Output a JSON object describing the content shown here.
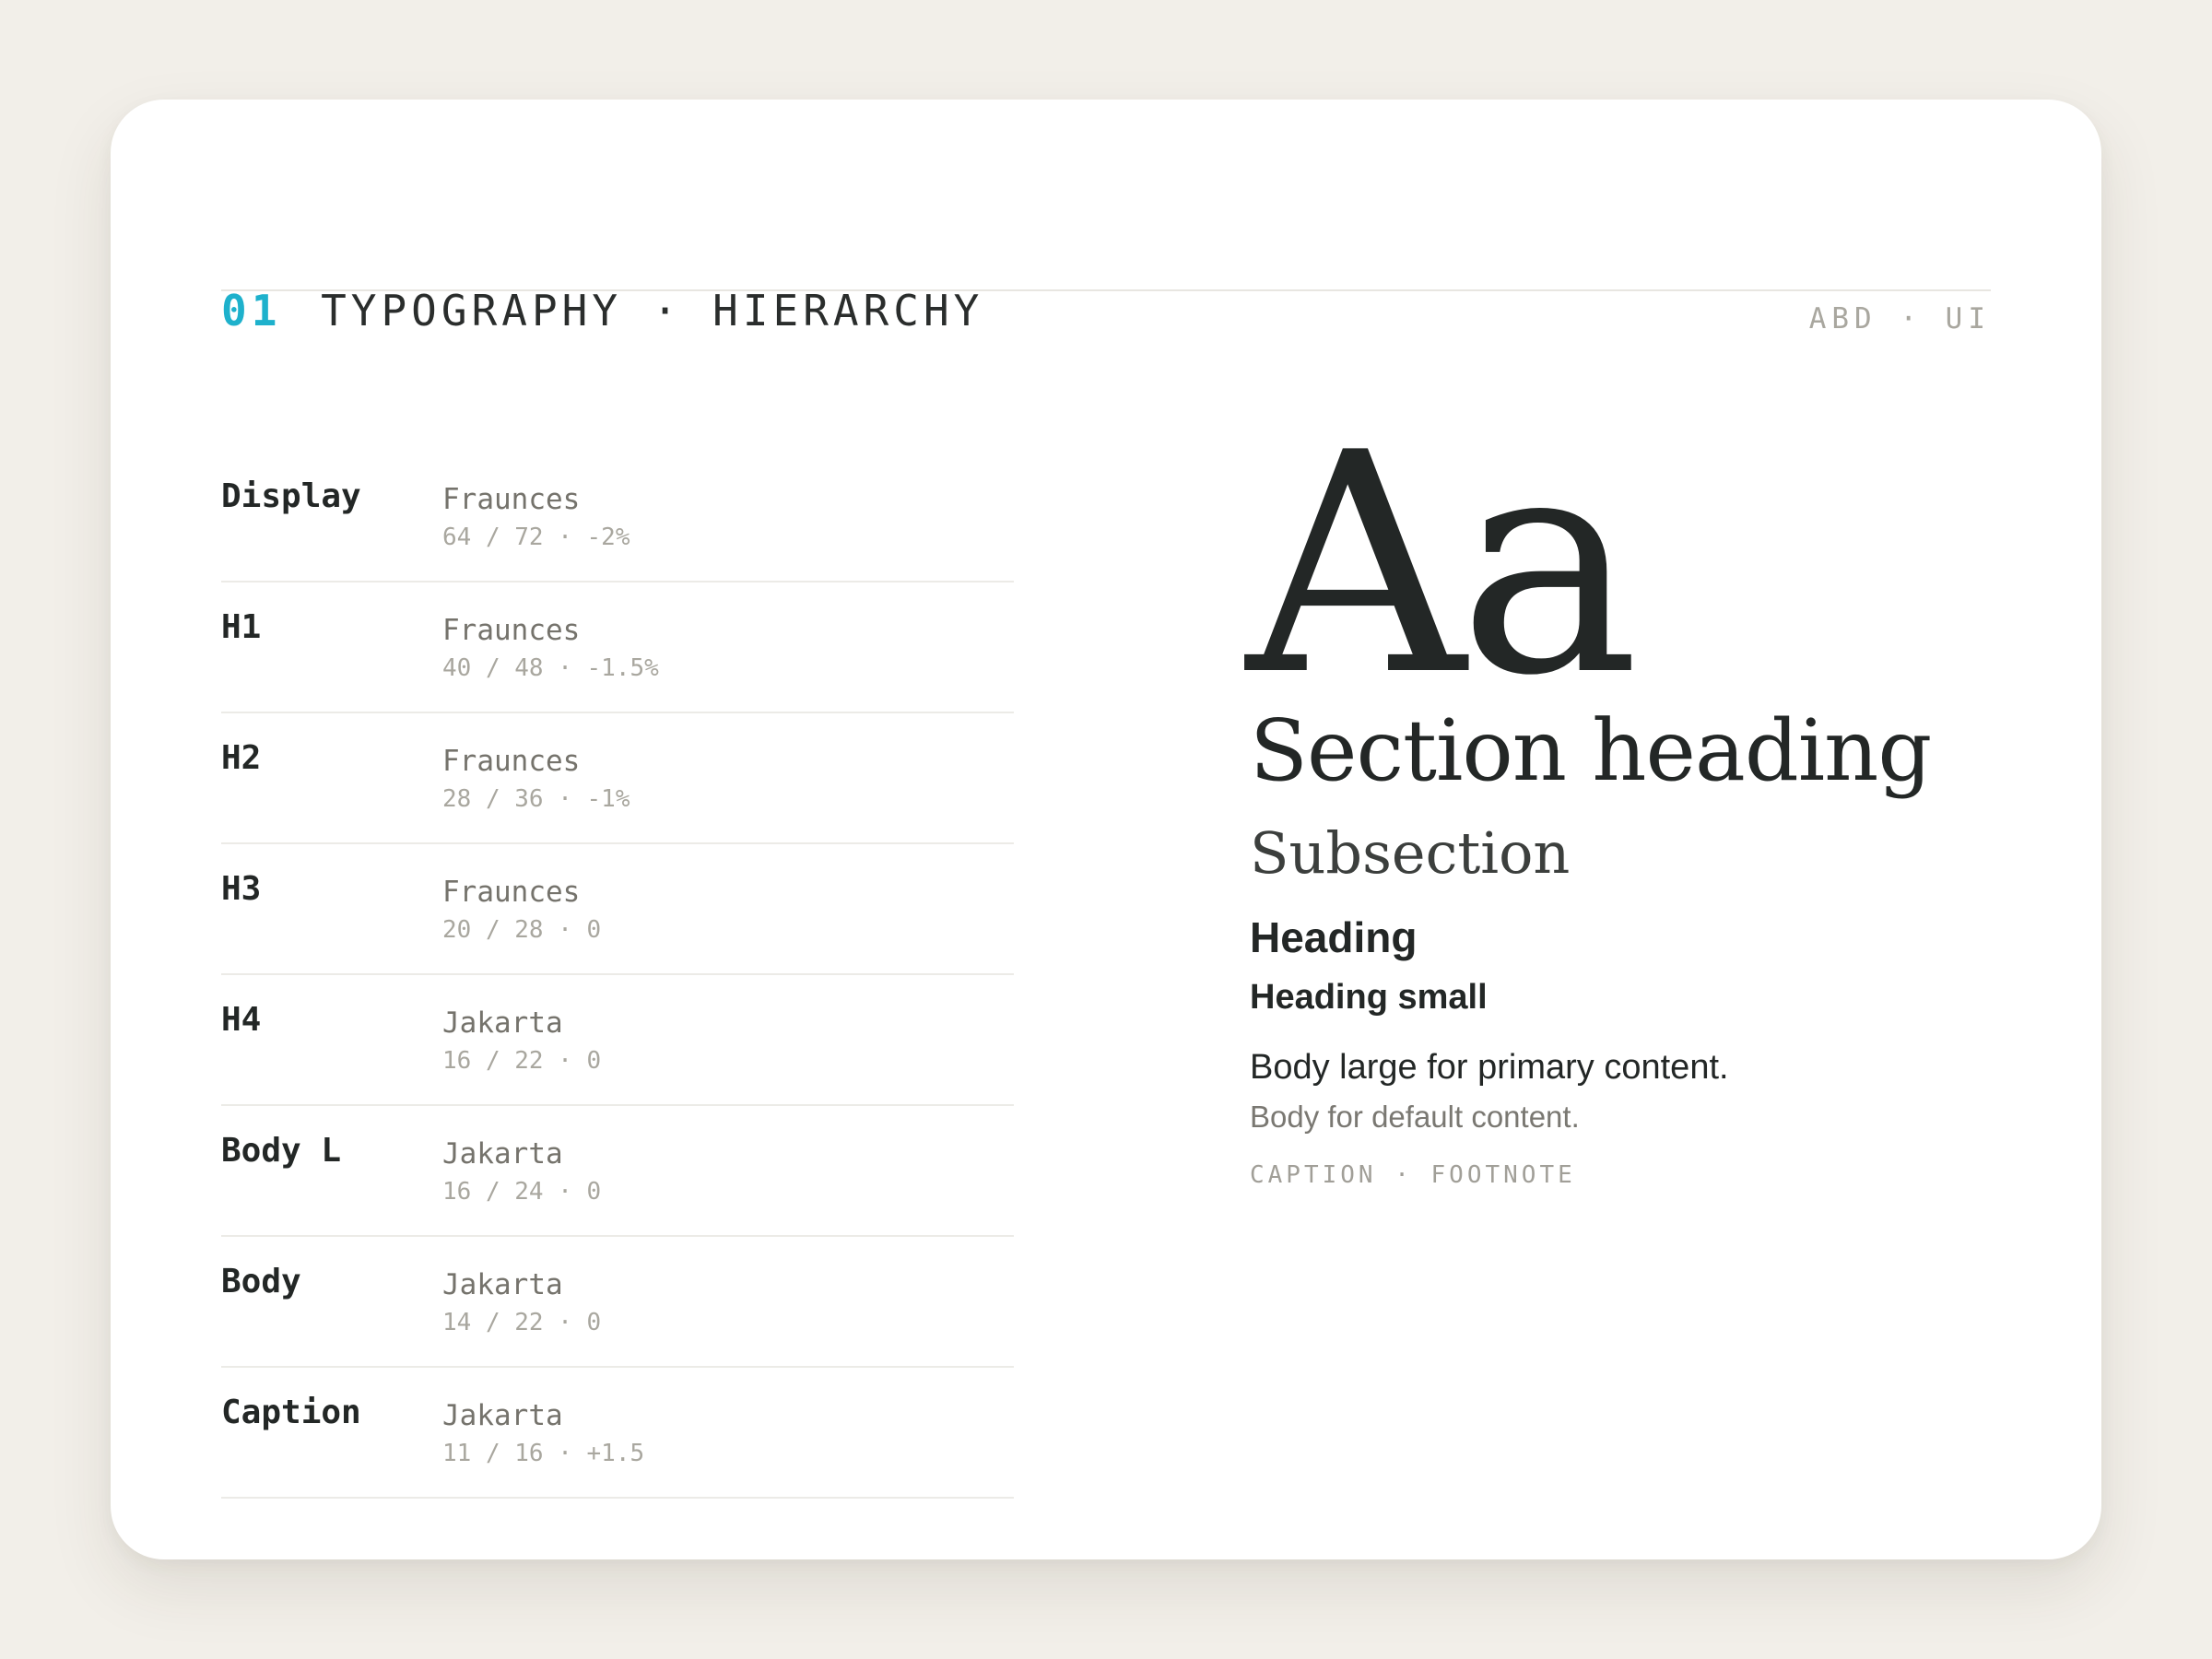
{
  "header": {
    "section_number": "01",
    "section_title": "TYPOGRAPHY · HIERARCHY",
    "brand": "ABD · UI"
  },
  "type_scale": [
    {
      "name": "Display",
      "font": "Fraunces",
      "metrics": "64 / 72 · -2%"
    },
    {
      "name": "H1",
      "font": "Fraunces",
      "metrics": "40 / 48 · -1.5%"
    },
    {
      "name": "H2",
      "font": "Fraunces",
      "metrics": "28 / 36 · -1%"
    },
    {
      "name": "H3",
      "font": "Fraunces",
      "metrics": "20 / 28 · 0"
    },
    {
      "name": "H4",
      "font": "Jakarta",
      "metrics": "16 / 22 · 0"
    },
    {
      "name": "Body L",
      "font": "Jakarta",
      "metrics": "16 / 24 · 0"
    },
    {
      "name": "Body",
      "font": "Jakarta",
      "metrics": "14 / 22 · 0"
    },
    {
      "name": "Caption",
      "font": "Jakarta",
      "metrics": "11 / 16 · +1.5"
    }
  ],
  "specimen": {
    "display": "Aa",
    "h1": "Section heading",
    "h2": "Subsection",
    "h3": "Heading",
    "h4": "Heading small",
    "body_large": "Body large for primary content.",
    "body": "Body for default content.",
    "caption": "CAPTION · FOOTNOTE"
  },
  "colors": {
    "accent": "#1eb1cc",
    "ink": "#232726",
    "muted": "#75736c",
    "subtle": "#a9a79f",
    "page_background": "#f2efe9",
    "card_background": "#ffffff"
  }
}
